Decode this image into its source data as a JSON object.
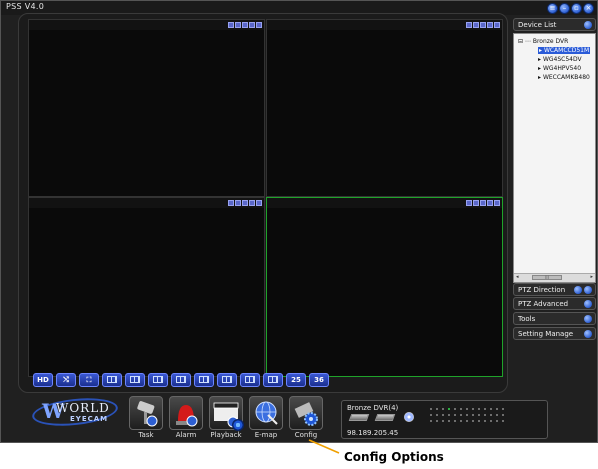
{
  "window": {
    "title": "PSS  V4.0"
  },
  "toolbar": {
    "hd_label": "HD",
    "split25_label": "25",
    "split36_label": "36"
  },
  "sidebar": {
    "device_list_title": "Device List",
    "tree": {
      "root": "Bronze DVR",
      "cameras": [
        "WCAMCCD51M",
        "WG4SC54DV",
        "WG4HPV540",
        "WECCAMKB480"
      ],
      "selected_index": 0
    },
    "sections": [
      "PTZ Direction",
      "PTZ Advanced",
      "Tools",
      "Setting Manage"
    ]
  },
  "logo": {
    "line1": "WORLD",
    "line2": "EYECAM"
  },
  "bottom_buttons": [
    {
      "label": "Task",
      "icon": "task-camera-icon"
    },
    {
      "label": "Alarm",
      "icon": "alarm-siren-icon"
    },
    {
      "label": "Playback",
      "icon": "playback-film-icon"
    },
    {
      "label": "E-map",
      "icon": "emap-globe-icon"
    },
    {
      "label": "Config",
      "icon": "config-gear-icon"
    }
  ],
  "status": {
    "dvr_name": "Bronze DVR(4)",
    "ip": "98.189.205.45"
  },
  "annotation": {
    "text": "Config Options"
  },
  "colors": {
    "background": "#202020",
    "accent_blue": "#2d5fd3",
    "active_pane": "#1fa32a"
  }
}
